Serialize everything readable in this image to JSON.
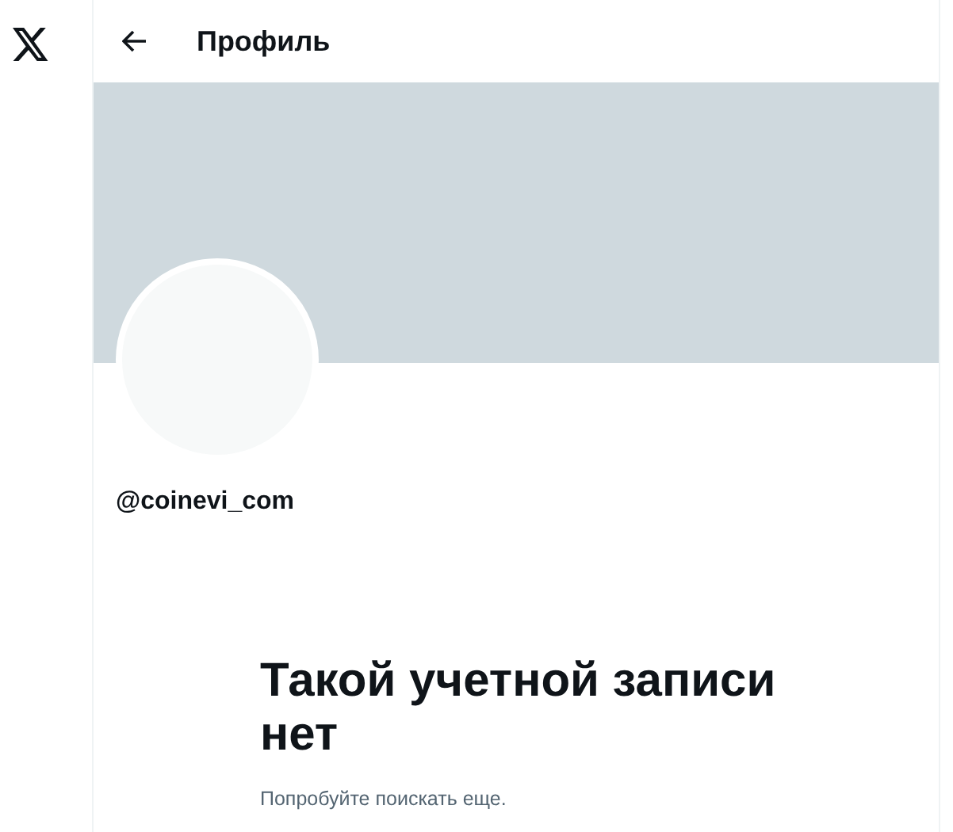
{
  "header": {
    "title": "Профиль"
  },
  "profile": {
    "handle": "@coinevi_com"
  },
  "empty_state": {
    "title": "Такой учетной записи нет",
    "subtitle": "Попробуйте поискать еще."
  }
}
